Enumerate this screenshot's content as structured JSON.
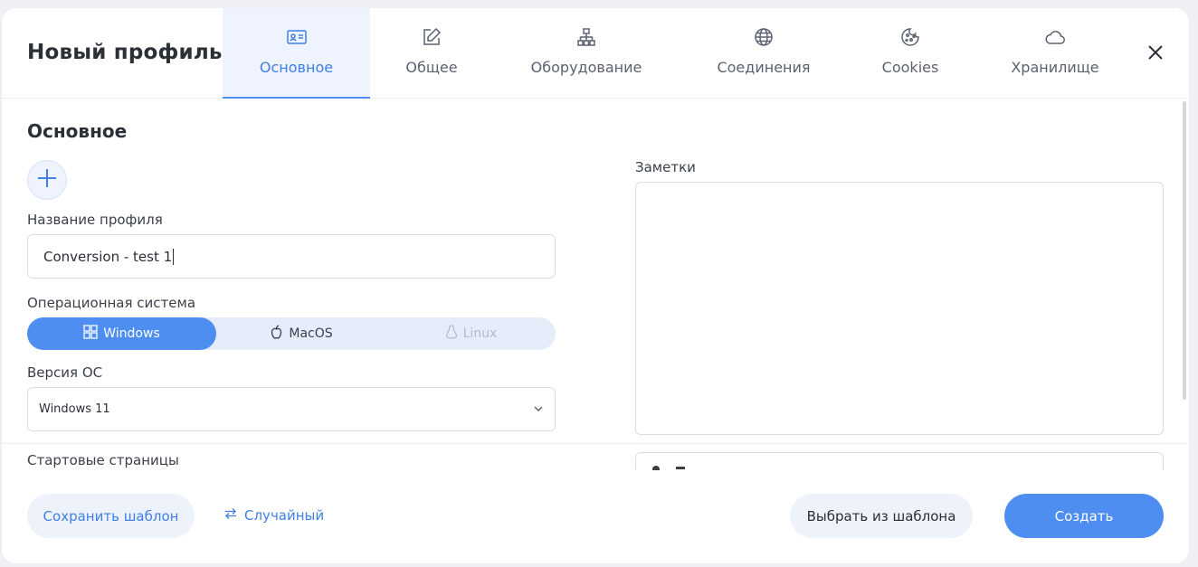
{
  "header": {
    "title": "Новый профиль",
    "tabs": [
      {
        "label": "Основное",
        "icon": "id-card-icon",
        "active": true
      },
      {
        "label": "Общее",
        "icon": "edit-icon",
        "active": false
      },
      {
        "label": "Оборудование",
        "icon": "hierarchy-icon",
        "active": false
      },
      {
        "label": "Соединения",
        "icon": "globe-icon",
        "active": false
      },
      {
        "label": "Cookies",
        "icon": "cookie-icon",
        "active": false
      },
      {
        "label": "Хранилище",
        "icon": "cloud-icon",
        "active": false
      }
    ]
  },
  "basic": {
    "section_title": "Основное",
    "profile_name_label": "Название профиля",
    "profile_name_value": "Conversion - test 1",
    "os_label": "Операционная система",
    "os_options": [
      {
        "label": "Windows",
        "icon": "windows-icon",
        "selected": true
      },
      {
        "label": "MacOS",
        "icon": "apple-icon",
        "selected": false
      },
      {
        "label": "Linux",
        "icon": "linux-icon",
        "selected": false,
        "disabled": true
      }
    ],
    "os_version_label": "Версия ОС",
    "os_version_value": "Windows 11",
    "start_pages_label": "Стартовые страницы",
    "notes_label": "Заметки"
  },
  "footer": {
    "save_template": "Сохранить шаблон",
    "random": "Случайный",
    "choose_template": "Выбрать из шаблона",
    "create": "Создать"
  },
  "colors": {
    "accent": "#4e8ef0",
    "accent_text": "#3f7fe6",
    "soft_bg": "#eef2fb"
  }
}
